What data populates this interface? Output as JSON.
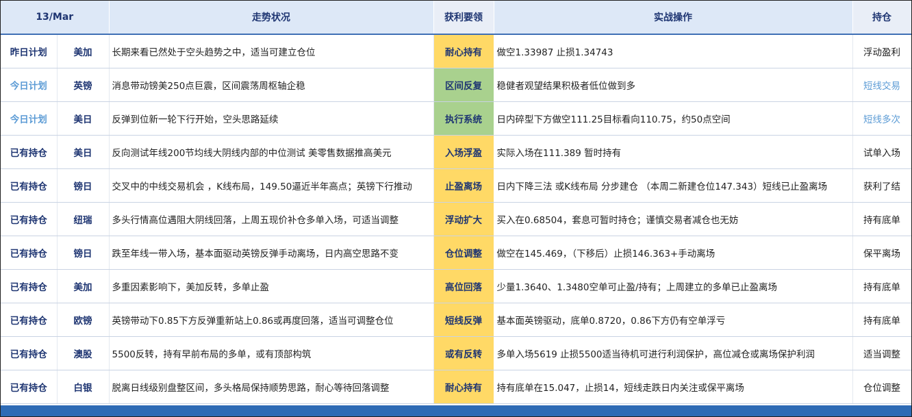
{
  "header": {
    "date": "13/Mar",
    "trend": "走势状况",
    "key": "获利要领",
    "action": "实战操作",
    "position": "持仓"
  },
  "colors": {
    "header_bg": "#dde8f7",
    "header_text": "#1e3572",
    "key_yellow": "#ffd966",
    "key_green": "#a9d18e",
    "today_text": "#5b9bd5",
    "footer_bar": "#2e6bb5"
  },
  "rows": [
    {
      "status": "昨日计划",
      "pair": "美加",
      "trend": "长期来看已然处于空头趋势之中，适当可建立仓位",
      "key": "耐心持有",
      "action": "做空1.33987  止损1.34743",
      "position": "浮动盈利"
    },
    {
      "status": "今日计划",
      "pair": "英镑",
      "trend": "消息带动镑美250点巨震，区间震荡周枢轴企稳",
      "key": "区间反复",
      "action": "稳健者观望结果积极者低位做到多",
      "position": "短线交易"
    },
    {
      "status": "今日计划",
      "pair": "美日",
      "trend": "反弹到位新一轮下行开始，空头思路延续",
      "key": "执行系统",
      "action": "日内碎型下方做空111.25目标看向110.75，约50点空间",
      "position": "短线多次"
    },
    {
      "status": "已有持仓",
      "pair": "美日",
      "trend": "反向测试年线200节均线大阴线内部的中位测试     美零售数据推高美元",
      "key": "入场浮盈",
      "action": "实际入场在111.389 暂时持有",
      "position": "试单入场"
    },
    {
      "status": "已有持仓",
      "pair": "镑日",
      "trend": "交叉中的中线交易机会 ，K线布局，149.50逼近半年高点；英镑下行推动",
      "key": "止盈离场",
      "action": "日内下降三法 或K线布局 分步建仓  （本周二新建仓位147.343）短线已止盈离场",
      "position": "获利了结"
    },
    {
      "status": "已有持仓",
      "pair": "纽瑞",
      "trend": "多头行情高位遇阻大阴线回落，上周五现价补仓多单入场，可适当调整",
      "key": "浮动扩大",
      "action": "买入在0.68504，套息可暂时持仓；谨慎交易者减仓也无妨",
      "position": "持有底单"
    },
    {
      "status": "已有持仓",
      "pair": "镑日",
      "trend": "跌至年线一带入场，基本面驱动英镑反弹手动离场，日内高空思路不变",
      "key": "仓位调整",
      "action": "做空在145.469，（下移后）止损146.363+手动离场",
      "position": "保平离场"
    },
    {
      "status": "已有持仓",
      "pair": "美加",
      "trend": "多重因素影响下，美加反转，多单止盈",
      "key": "高位回落",
      "action": "少量1.3640、1.3480空单可止盈/持有；上周建立的多单已止盈离场",
      "position": "持有底单"
    },
    {
      "status": "已有持仓",
      "pair": "欧镑",
      "trend": "英镑带动下0.85下方反弹重新站上0.86或再度回落，适当可调整仓位",
      "key": "短线反弹",
      "action": "基本面英镑驱动，底单0.8720，0.86下方仍有空单浮亏",
      "position": "持有底单"
    },
    {
      "status": "已有持仓",
      "pair": "澳股",
      "trend": "5500反转，持有早前布局的多单，或有顶部构筑",
      "key": "或有反转",
      "action": "多单入场5619 止损5500适当待机可进行利润保护，高位减仓或离场保护利润",
      "position": "适当调整"
    },
    {
      "status": "已有持仓",
      "pair": "白银",
      "trend": "脱离日线级别盘整区间，多头格局保持顺势思路，耐心等待回落调整",
      "key": "耐心持有",
      "action": "持有底单在15.047，止损14，短线走跌日内关注或保平离场",
      "position": "仓位调整"
    }
  ]
}
